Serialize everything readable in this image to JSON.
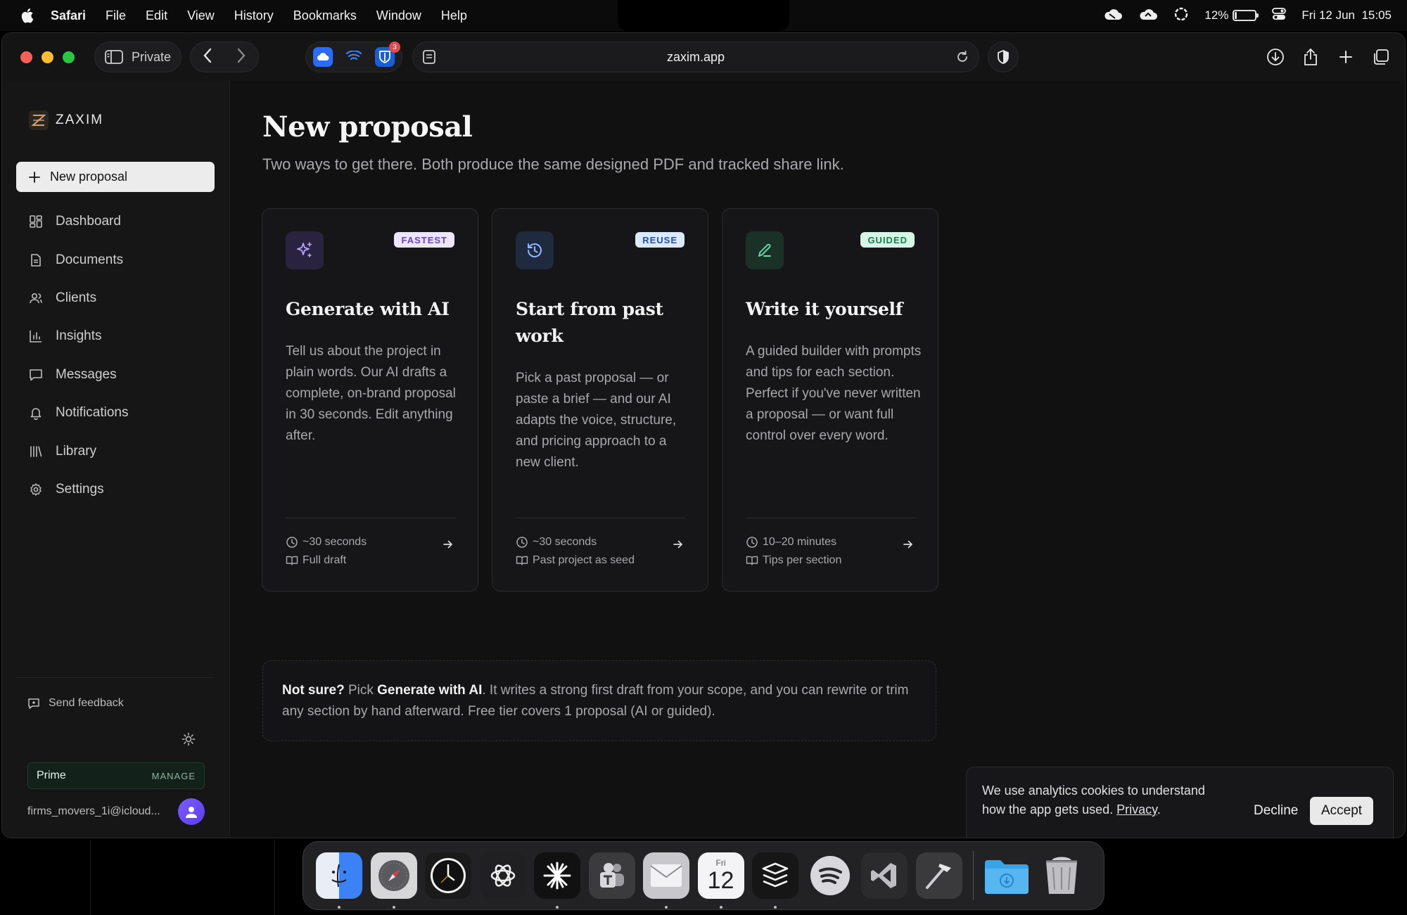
{
  "menubar": {
    "app": "Safari",
    "menus": [
      "File",
      "Edit",
      "View",
      "History",
      "Bookmarks",
      "Window",
      "Help"
    ],
    "battery_percent": "12%",
    "battery_level": 0.12,
    "datetime": "Fri 12 Jun  15:05"
  },
  "browser": {
    "private_label": "Private",
    "url": "zaxim.app",
    "extension_badge": "3"
  },
  "sidebar": {
    "brand": "ZAXIM",
    "new_button": "New proposal",
    "items": [
      {
        "label": "Dashboard",
        "icon": "grid-icon"
      },
      {
        "label": "Documents",
        "icon": "document-icon"
      },
      {
        "label": "Clients",
        "icon": "users-icon"
      },
      {
        "label": "Insights",
        "icon": "chart-icon"
      },
      {
        "label": "Messages",
        "icon": "message-icon"
      },
      {
        "label": "Notifications",
        "icon": "bell-icon"
      },
      {
        "label": "Library",
        "icon": "library-icon"
      },
      {
        "label": "Settings",
        "icon": "gear-icon"
      }
    ],
    "feedback": "Send feedback",
    "plan": "Prime",
    "manage": "MANAGE",
    "user_email": "firms_movers_1i@icloud..."
  },
  "main": {
    "title": "New proposal",
    "subtitle": "Two ways to get there. Both produce the same designed PDF and tracked share link.",
    "cards": [
      {
        "badge": "FASTEST",
        "title": "Generate with AI",
        "desc": "Tell us about the project in plain words. Our AI drafts a complete, on-brand proposal in 30 seconds. Edit anything after.",
        "time": "~30 seconds",
        "detail": "Full draft",
        "icon": "sparkle-icon",
        "accent": "#a78bfa"
      },
      {
        "badge": "REUSE",
        "title": "Start from past work",
        "desc": "Pick a past proposal — or paste a brief — and our AI adapts the voice, structure, and pricing approach to a new client.",
        "time": "~30 seconds",
        "detail": "Past project as seed",
        "icon": "history-icon",
        "accent": "#60a5fa"
      },
      {
        "badge": "GUIDED",
        "title": "Write it yourself",
        "desc": "A guided builder with prompts and tips for each section. Perfect if you've never written a proposal — or want full control over every word.",
        "time": "10–20 minutes",
        "detail": "Tips per section",
        "icon": "pencil-icon",
        "accent": "#34d399"
      }
    ],
    "hint": {
      "lead": "Not sure?",
      "pick": " Pick ",
      "choice": "Generate with AI",
      "rest": ". It writes a strong first draft from your scope, and you can rewrite or trim any section by hand afterward. Free tier covers 1 proposal (AI or guided)."
    }
  },
  "cookie": {
    "text": "We use analytics cookies to understand how the app gets used. ",
    "link": "Privacy",
    "after": ".",
    "decline": "Decline",
    "accept": "Accept"
  },
  "dock": {
    "calendar_day": "Fri",
    "calendar_date": "12",
    "apps": [
      "finder-icon",
      "safari-icon",
      "clock-icon",
      "chatgpt-icon",
      "perplexity-icon",
      "teams-icon",
      "mail-icon",
      "calendar-icon",
      "stack-icon",
      "spotify-icon",
      "vscode-icon",
      "xcode-icon",
      "downloads-folder-icon",
      "trash-icon"
    ]
  }
}
